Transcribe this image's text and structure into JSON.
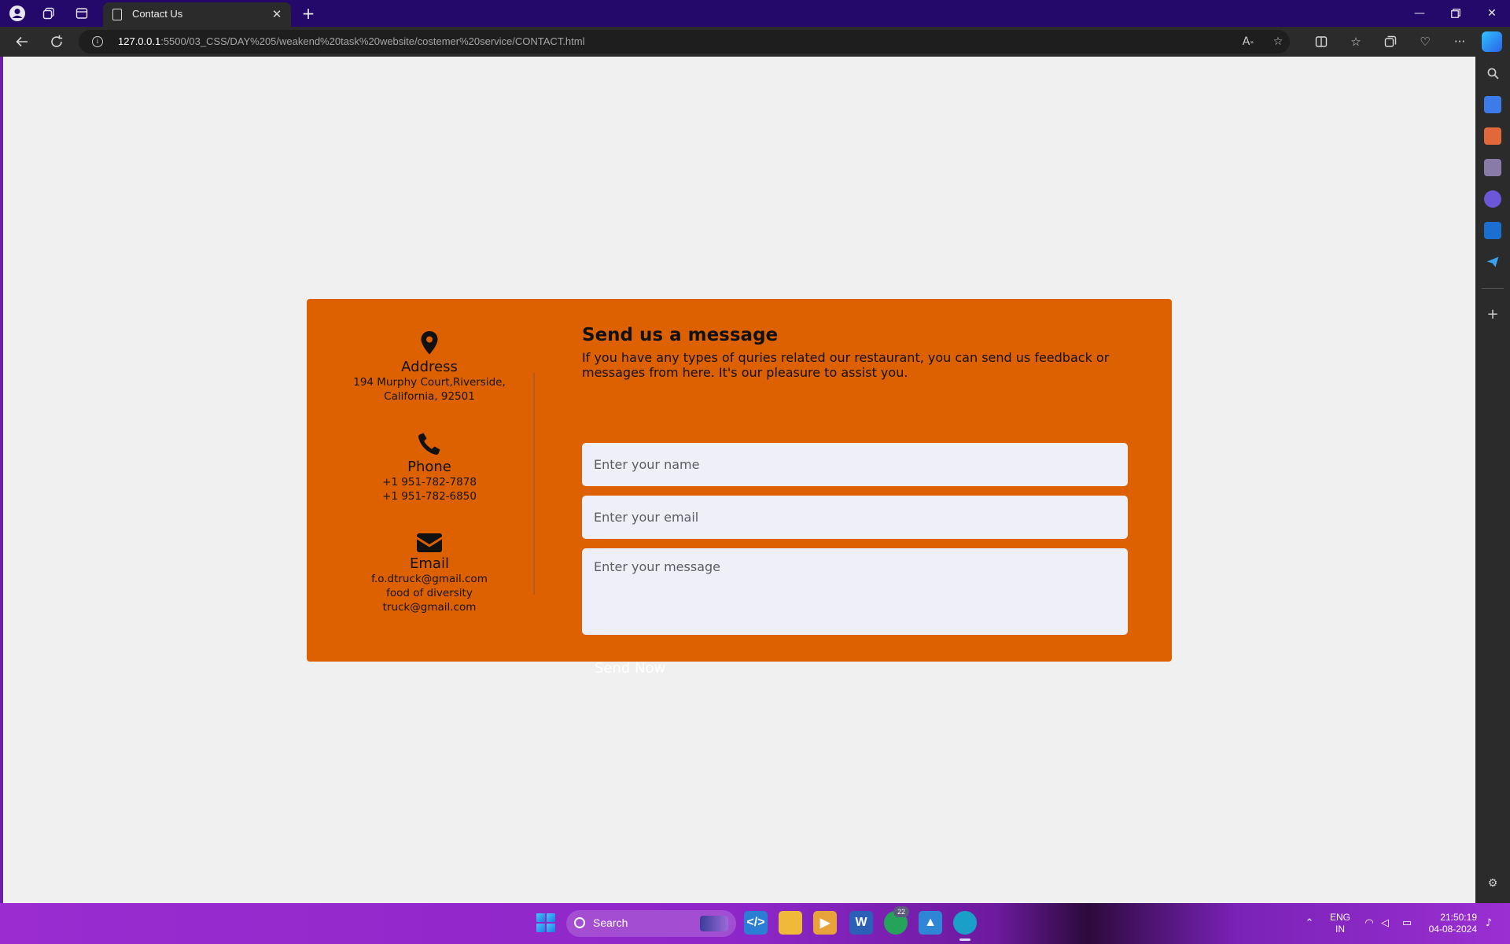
{
  "browser": {
    "tab_title": "Contact Us",
    "url_host": "127.0.0.1",
    "url_path": ":5500/03_CSS/DAY%205/weakend%20task%20website/costemer%20service/CONTACT.html"
  },
  "contact": {
    "address": {
      "icon": "map-pin-icon",
      "heading": "Address",
      "lines": [
        "194 Murphy Court,Riverside,",
        "California, 92501"
      ]
    },
    "phone": {
      "icon": "phone-icon",
      "heading": "Phone",
      "lines": [
        "+1 951-782-7878",
        "+1 951-782-6850"
      ]
    },
    "email": {
      "icon": "envelope-icon",
      "heading": "Email",
      "lines": [
        "f.o.dtruck@gmail.com",
        "food of diversity",
        "truck@gmail.com"
      ]
    }
  },
  "form": {
    "title": "Send us a message",
    "description": "If you have any types of quries related our restaurant, you can send us feedback or messages from here. It's our pleasure to assist you.",
    "name_placeholder": "Enter your name",
    "email_placeholder": "Enter your email",
    "message_placeholder": "Enter your message",
    "submit_label": "Send Now"
  },
  "taskbar": {
    "search_label": "Search",
    "whatsapp_badge": "22",
    "lang_line1": "ENG",
    "lang_line2": "IN",
    "time": "21:50:19",
    "date": "04-08-2024"
  },
  "colors": {
    "card": "#dd6100",
    "page_bg": "#f0f0f0",
    "titlebar": "#24086a",
    "input_bg": "#efeff8"
  }
}
